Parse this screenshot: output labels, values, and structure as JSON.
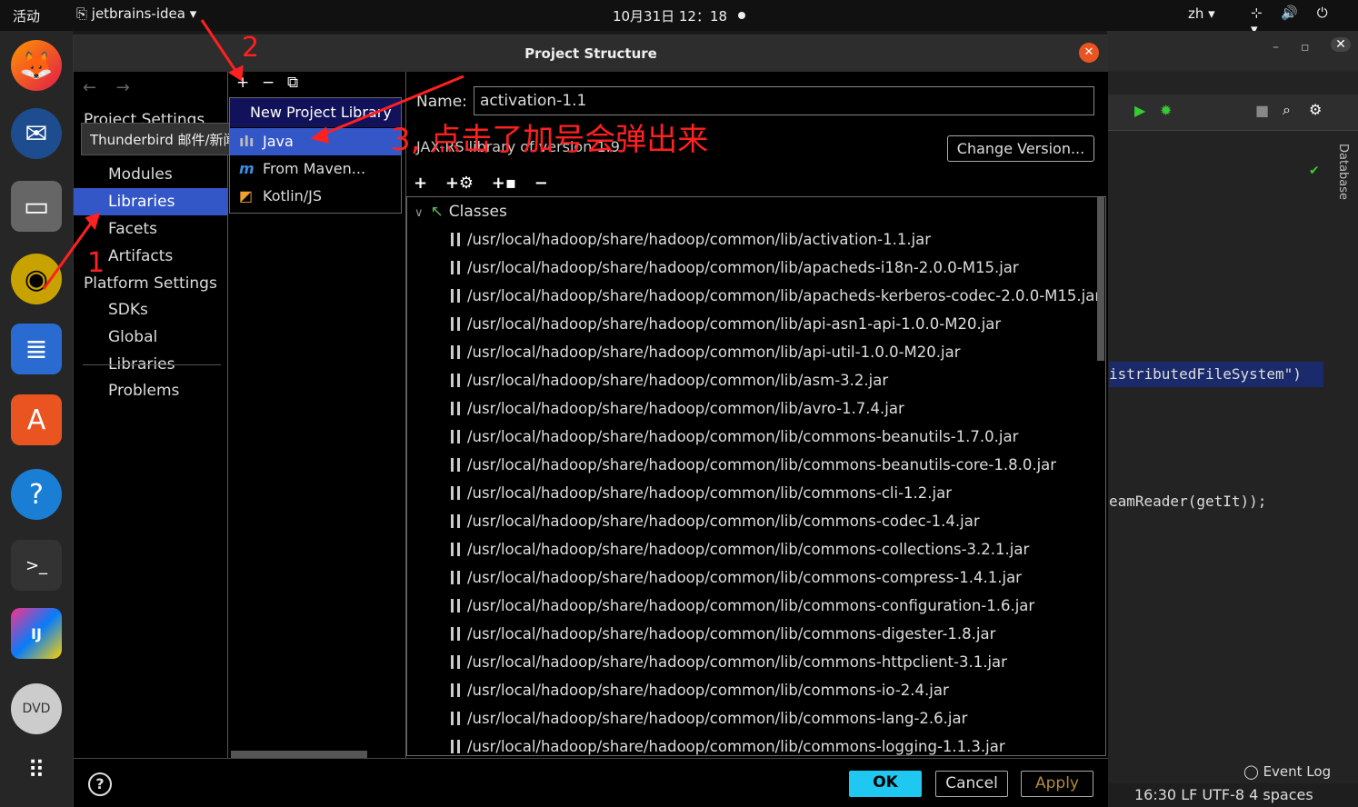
{
  "topbar": {
    "activities": "活动",
    "app_name": "jetbrains-idea",
    "clock": "10月31日 12：18",
    "lang": "zh",
    "sys_icons": "⊹ 🔊 ⏻ ▾"
  },
  "dock": {
    "apps": [
      "firefox-icon",
      "thunderbird-icon",
      "files-icon",
      "rhythmbox-icon",
      "writer-icon",
      "software-center-icon",
      "help-icon",
      "terminal-icon",
      "intellij-icon",
      "dvd-icon",
      "app-grid-icon"
    ]
  },
  "dialog": {
    "title": "Project Structure",
    "nav_arrows": "← →",
    "tooltip": "Thunderbird 邮件/新闻",
    "sections": {
      "project_settings": "Project Settings",
      "modules": "Modules",
      "libraries": "Libraries",
      "facets": "Facets",
      "artifacts": "Artifacts",
      "platform_settings": "Platform Settings",
      "sdks": "SDKs",
      "global_libraries": "Global Libraries",
      "problems": "Problems"
    },
    "mid_toolbar": {
      "add": "+",
      "remove": "−",
      "copy": "⧉"
    },
    "popup": {
      "header": "New Project Library",
      "items": [
        {
          "label": "Java",
          "icon": "lib-icon"
        },
        {
          "label": "From Maven...",
          "icon": "maven-icon"
        },
        {
          "label": "Kotlin/JS",
          "icon": "kotlinjs-icon"
        }
      ]
    },
    "name_label": "Name:",
    "name_value": "activation-1.1",
    "description": "JAX-RS library of version 1.9",
    "change_version": "Change Version...",
    "tree_toolbar": [
      "+",
      "+⚙",
      "+▪",
      "−"
    ],
    "tree_root": "Classes",
    "jars": [
      "/usr/local/hadoop/share/hadoop/common/lib/activation-1.1.jar",
      "/usr/local/hadoop/share/hadoop/common/lib/apacheds-i18n-2.0.0-M15.jar",
      "/usr/local/hadoop/share/hadoop/common/lib/apacheds-kerberos-codec-2.0.0-M15.jar",
      "/usr/local/hadoop/share/hadoop/common/lib/api-asn1-api-1.0.0-M20.jar",
      "/usr/local/hadoop/share/hadoop/common/lib/api-util-1.0.0-M20.jar",
      "/usr/local/hadoop/share/hadoop/common/lib/asm-3.2.jar",
      "/usr/local/hadoop/share/hadoop/common/lib/avro-1.7.4.jar",
      "/usr/local/hadoop/share/hadoop/common/lib/commons-beanutils-1.7.0.jar",
      "/usr/local/hadoop/share/hadoop/common/lib/commons-beanutils-core-1.8.0.jar",
      "/usr/local/hadoop/share/hadoop/common/lib/commons-cli-1.2.jar",
      "/usr/local/hadoop/share/hadoop/common/lib/commons-codec-1.4.jar",
      "/usr/local/hadoop/share/hadoop/common/lib/commons-collections-3.2.1.jar",
      "/usr/local/hadoop/share/hadoop/common/lib/commons-compress-1.4.1.jar",
      "/usr/local/hadoop/share/hadoop/common/lib/commons-configuration-1.6.jar",
      "/usr/local/hadoop/share/hadoop/common/lib/commons-digester-1.8.jar",
      "/usr/local/hadoop/share/hadoop/common/lib/commons-httpclient-3.1.jar",
      "/usr/local/hadoop/share/hadoop/common/lib/commons-io-2.4.jar",
      "/usr/local/hadoop/share/hadoop/common/lib/commons-lang-2.6.jar",
      "/usr/local/hadoop/share/hadoop/common/lib/commons-logging-1.1.3.jar"
    ],
    "buttons": {
      "help": "?",
      "ok": "OK",
      "cancel": "Cancel",
      "apply": "Apply"
    }
  },
  "ide_bg": {
    "code1": "istributedFileSystem\")",
    "code2": "eamReader(getIt));",
    "database_tab": "Database",
    "event_log": "Event Log",
    "status": "16:30  LF  UTF-8  4 spaces"
  },
  "annotations": {
    "a1": "1",
    "a2": "2",
    "a3": "3, 点击了加号会弹出来",
    "color": "#ff2020"
  }
}
